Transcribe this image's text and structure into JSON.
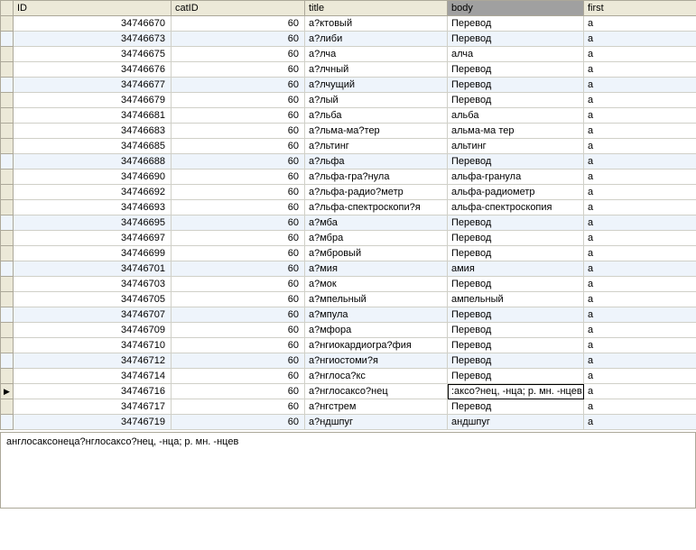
{
  "columns": [
    "ID",
    "catID",
    "title",
    "body",
    "first"
  ],
  "selectedColumnIndex": 3,
  "selectedRowIndex": 25,
  "altRows": [
    1,
    4,
    9,
    13,
    16,
    19,
    22,
    26
  ],
  "rows": [
    {
      "id": "34746670",
      "cat": "60",
      "title": "а?ктовый",
      "body": "Перевод",
      "first": "а"
    },
    {
      "id": "34746673",
      "cat": "60",
      "title": "а?либи",
      "body": "Перевод",
      "first": "а"
    },
    {
      "id": "34746675",
      "cat": "60",
      "title": "а?лча",
      "body": "алча",
      "first": "а"
    },
    {
      "id": "34746676",
      "cat": "60",
      "title": "а?лчный",
      "body": "Перевод",
      "first": "а"
    },
    {
      "id": "34746677",
      "cat": "60",
      "title": "а?лчущий",
      "body": "Перевод",
      "first": "а"
    },
    {
      "id": "34746679",
      "cat": "60",
      "title": "а?лый",
      "body": "Перевод",
      "first": "а"
    },
    {
      "id": "34746681",
      "cat": "60",
      "title": "а?льба",
      "body": "альба",
      "first": "а"
    },
    {
      "id": "34746683",
      "cat": "60",
      "title": "а?льма-ма?тер",
      "body": "альма-ма тер",
      "first": "а"
    },
    {
      "id": "34746685",
      "cat": "60",
      "title": "а?льтинг",
      "body": "альтинг",
      "first": "а"
    },
    {
      "id": "34746688",
      "cat": "60",
      "title": "а?льфа",
      "body": "Перевод",
      "first": "а"
    },
    {
      "id": "34746690",
      "cat": "60",
      "title": "а?льфа-гра?нула",
      "body": "альфа-гранула",
      "first": "а"
    },
    {
      "id": "34746692",
      "cat": "60",
      "title": "а?льфа-радио?метр",
      "body": "альфа-радиометр",
      "first": "а"
    },
    {
      "id": "34746693",
      "cat": "60",
      "title": "а?льфа-спектроскопи?я",
      "body": "альфа-спектроскопия",
      "first": "а"
    },
    {
      "id": "34746695",
      "cat": "60",
      "title": "а?мба",
      "body": "Перевод",
      "first": "а"
    },
    {
      "id": "34746697",
      "cat": "60",
      "title": "а?мбра",
      "body": "Перевод",
      "first": "а"
    },
    {
      "id": "34746699",
      "cat": "60",
      "title": "а?мбровый",
      "body": "Перевод",
      "first": "а"
    },
    {
      "id": "34746701",
      "cat": "60",
      "title": "а?мия",
      "body": "амия",
      "first": "а"
    },
    {
      "id": "34746703",
      "cat": "60",
      "title": "а?мок",
      "body": "Перевод",
      "first": "а"
    },
    {
      "id": "34746705",
      "cat": "60",
      "title": "а?мпельный",
      "body": "ампельный",
      "first": "а"
    },
    {
      "id": "34746707",
      "cat": "60",
      "title": "а?мпула",
      "body": "Перевод",
      "first": "а"
    },
    {
      "id": "34746709",
      "cat": "60",
      "title": "а?мфора",
      "body": "Перевод",
      "first": "а"
    },
    {
      "id": "34746710",
      "cat": "60",
      "title": "а?нгиокардиогра?фия",
      "body": "Перевод",
      "first": "а"
    },
    {
      "id": "34746712",
      "cat": "60",
      "title": "а?нгиостоми?я",
      "body": "Перевод",
      "first": "а"
    },
    {
      "id": "34746714",
      "cat": "60",
      "title": "а?нглоса?кс",
      "body": "Перевод",
      "first": "а"
    },
    {
      "id": "34746716",
      "cat": "60",
      "title": "а?нглосаксо?нец",
      "body": ":аксо?нец, -нца; р. мн. -нцев",
      "first": "а"
    },
    {
      "id": "34746717",
      "cat": "60",
      "title": "а?нгстрем",
      "body": "Перевод",
      "first": "а"
    },
    {
      "id": "34746719",
      "cat": "60",
      "title": "а?ндшпуг",
      "body": "андшпуг",
      "first": "а"
    }
  ],
  "detail": "англосаксонеца?нглосаксо?нец, -нца; р. мн. -нцев"
}
